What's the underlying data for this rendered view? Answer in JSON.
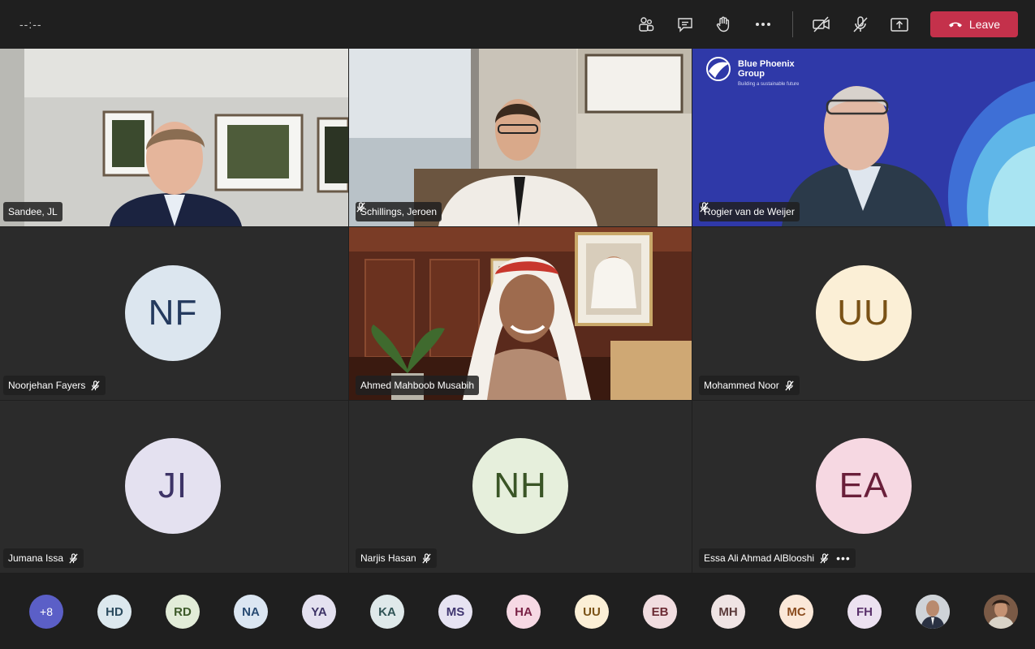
{
  "topbar": {
    "timer": "--:--",
    "icons": [
      "people-icon",
      "chat-icon",
      "raise-hand-icon",
      "more-options-icon",
      "camera-off-icon",
      "mic-off-icon",
      "share-screen-icon"
    ],
    "leave_label": "Leave"
  },
  "tiles": [
    {
      "name": "Sandee, JL",
      "muted": false,
      "type": "video"
    },
    {
      "name": "Schillings, Jeroen",
      "muted": true,
      "type": "video"
    },
    {
      "name": "Rogier van de Weijer",
      "muted": true,
      "type": "video",
      "brand": {
        "line1": "Blue Phoenix",
        "line2": "Group",
        "tagline": "Building a sustainable future"
      }
    },
    {
      "name": "Noorjehan Fayers",
      "muted": true,
      "type": "avatar",
      "initials": "NF",
      "bg": "#dce6ef",
      "fg": "#243a5e"
    },
    {
      "name": "Ahmed Mahboob Musabih",
      "muted": false,
      "type": "video"
    },
    {
      "name": "Mohammed Noor",
      "muted": true,
      "type": "avatar",
      "initials": "UU",
      "bg": "#fbefd6",
      "fg": "#7a5216"
    },
    {
      "name": "Jumana Issa",
      "muted": true,
      "type": "avatar",
      "initials": "JI",
      "bg": "#e4e1f0",
      "fg": "#3d3366"
    },
    {
      "name": "Narjis Hasan",
      "muted": true,
      "type": "avatar",
      "initials": "NH",
      "bg": "#e6efdc",
      "fg": "#3a5526"
    },
    {
      "name": "Essa Ali Ahmad AlBlooshi",
      "muted": true,
      "type": "avatar",
      "initials": "EA",
      "bg": "#f6d8e2",
      "fg": "#6a1f3a"
    }
  ],
  "overflow": {
    "count": "+8",
    "participants": [
      {
        "initials": "HD",
        "bg": "#dce8ee",
        "fg": "#2a4a5e"
      },
      {
        "initials": "RD",
        "bg": "#e2ecd8",
        "fg": "#3d5a29"
      },
      {
        "initials": "NA",
        "bg": "#dbe6f2",
        "fg": "#274a72"
      },
      {
        "initials": "YA",
        "bg": "#e4e1f0",
        "fg": "#3d3366"
      },
      {
        "initials": "KA",
        "bg": "#dfe9ea",
        "fg": "#2f5355"
      },
      {
        "initials": "MS",
        "bg": "#e6e3f2",
        "fg": "#403670"
      },
      {
        "initials": "HA",
        "bg": "#f6d9e4",
        "fg": "#7a2347"
      },
      {
        "initials": "UU",
        "bg": "#fbefd6",
        "fg": "#7a5216"
      },
      {
        "initials": "EB",
        "bg": "#f1dde0",
        "fg": "#6b2a33"
      },
      {
        "initials": "MH",
        "bg": "#efe4e4",
        "fg": "#5a3a3a"
      },
      {
        "initials": "MC",
        "bg": "#fbe8d8",
        "fg": "#8a4b1d"
      },
      {
        "initials": "FH",
        "bg": "#ece1f0",
        "fg": "#59306a"
      }
    ]
  }
}
